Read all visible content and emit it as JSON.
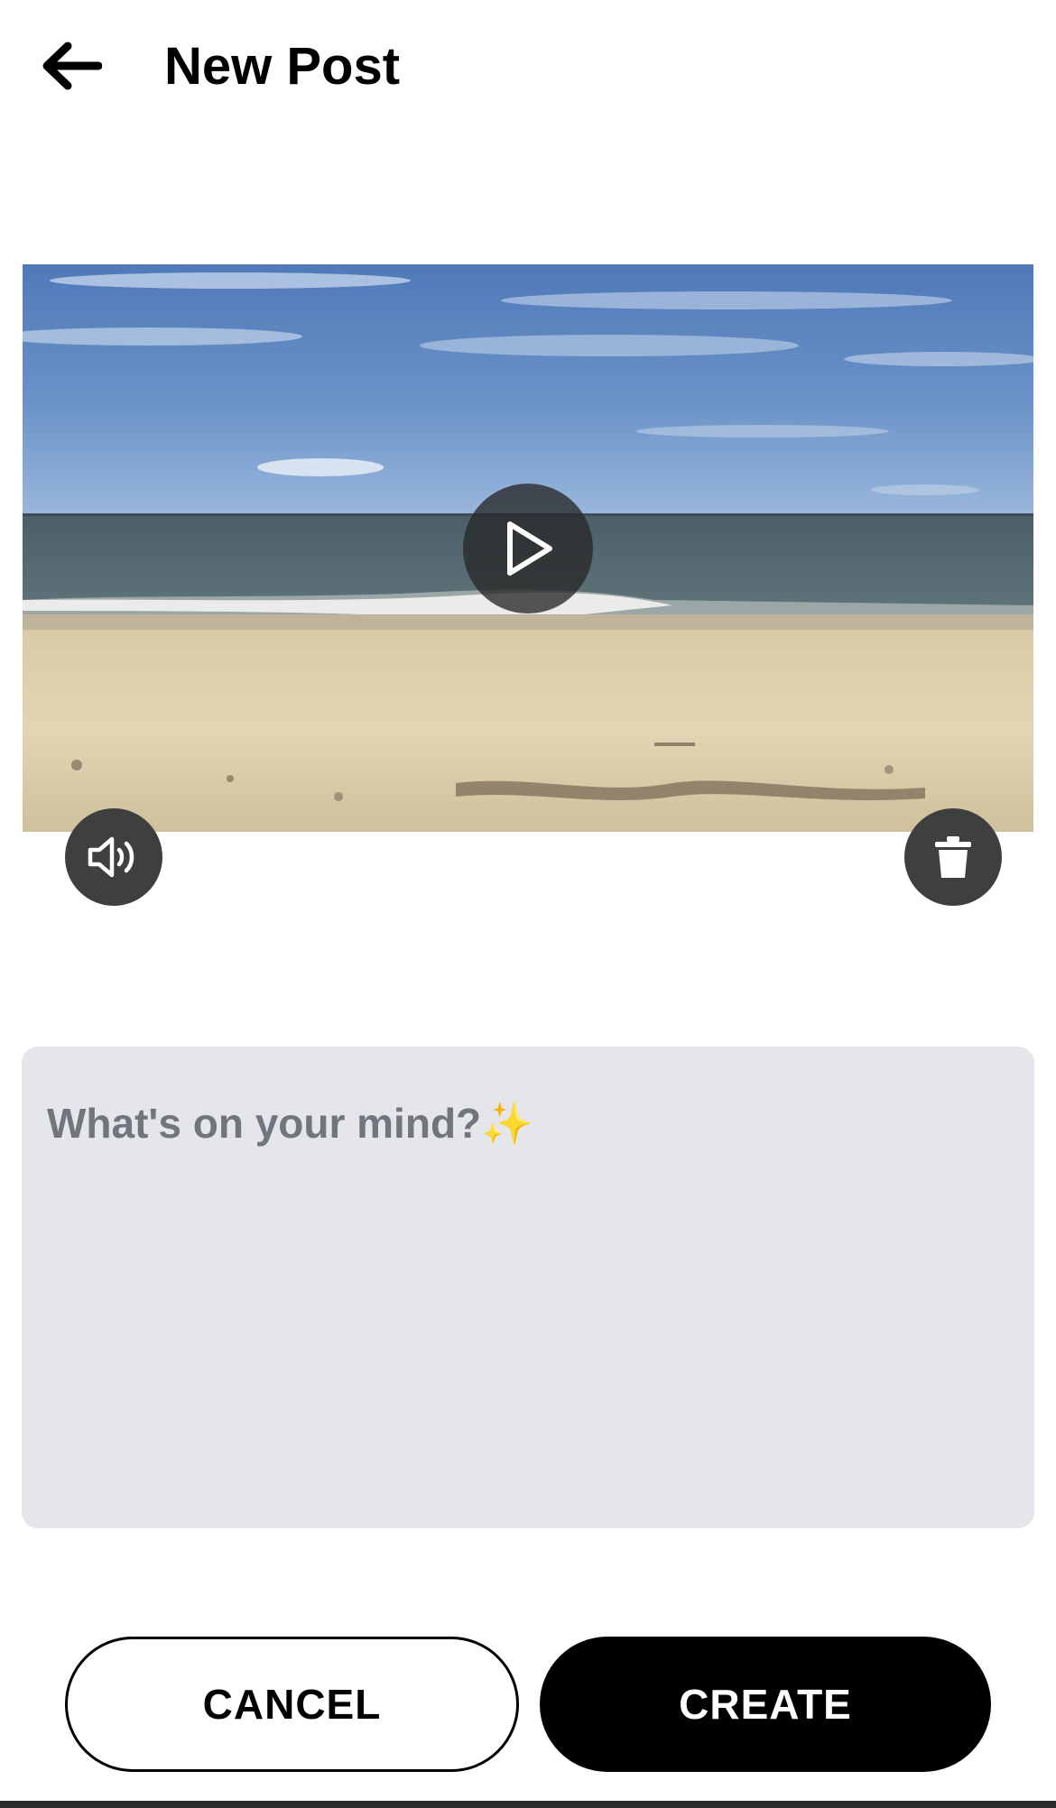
{
  "header": {
    "title": "New Post",
    "back_icon": "arrow-left-icon"
  },
  "media": {
    "type": "video",
    "play_icon": "play-icon",
    "sound_icon": "speaker-on-icon",
    "delete_icon": "trash-icon"
  },
  "composer": {
    "placeholder": "What's on your mind?✨",
    "value": ""
  },
  "actions": {
    "cancel_label": "CANCEL",
    "create_label": "CREATE"
  },
  "colors": {
    "composer_bg": "#e5e6ea",
    "placeholder": "#72747e",
    "primary": "#000000",
    "overlay_button": "#3f3f3f"
  }
}
